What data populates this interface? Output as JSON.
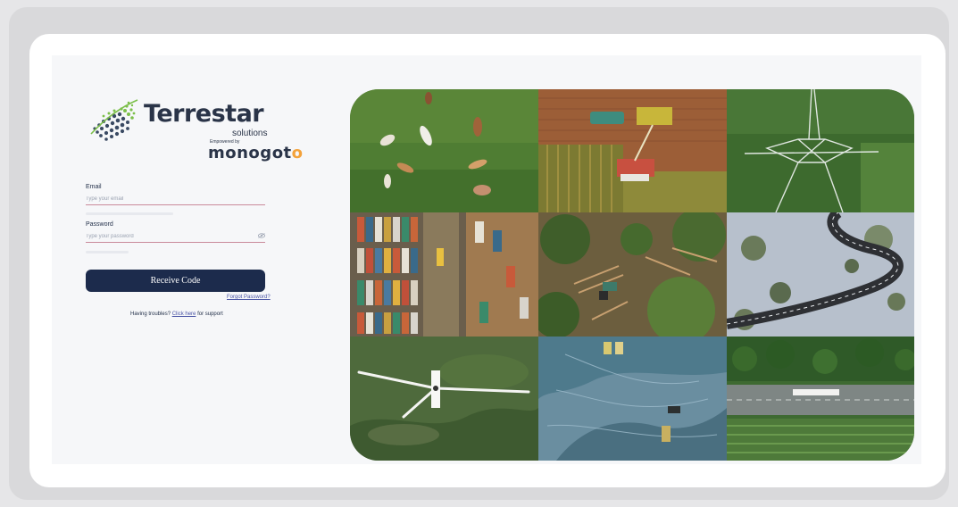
{
  "brand": {
    "name": "Terrestar",
    "tagline": "solutions",
    "empowered_by": "Empowered by",
    "partner_main": "monogot",
    "partner_accent": "o",
    "accent_color": "#f3a23b",
    "primary_color": "#1c2b4c"
  },
  "login": {
    "email_label": "Email",
    "email_placeholder": "Type your email",
    "password_label": "Password",
    "password_placeholder": "Type your password",
    "password_toggle_icon": "eye-icon",
    "submit_label": "Receive Code",
    "forgot_label": "Forgot Password?",
    "trouble_prefix": "Having troubles?",
    "trouble_link": "Click here",
    "trouble_suffix": "for support"
  },
  "mosaic": {
    "tiles": [
      {
        "name": "cattle-field-photo"
      },
      {
        "name": "harvester-field-photo"
      },
      {
        "name": "power-pylon-photo"
      },
      {
        "name": "container-port-photo"
      },
      {
        "name": "forest-logging-photo"
      },
      {
        "name": "snowy-road-photo"
      },
      {
        "name": "wind-turbine-photo"
      },
      {
        "name": "mining-site-photo"
      },
      {
        "name": "highway-truck-photo"
      }
    ]
  }
}
